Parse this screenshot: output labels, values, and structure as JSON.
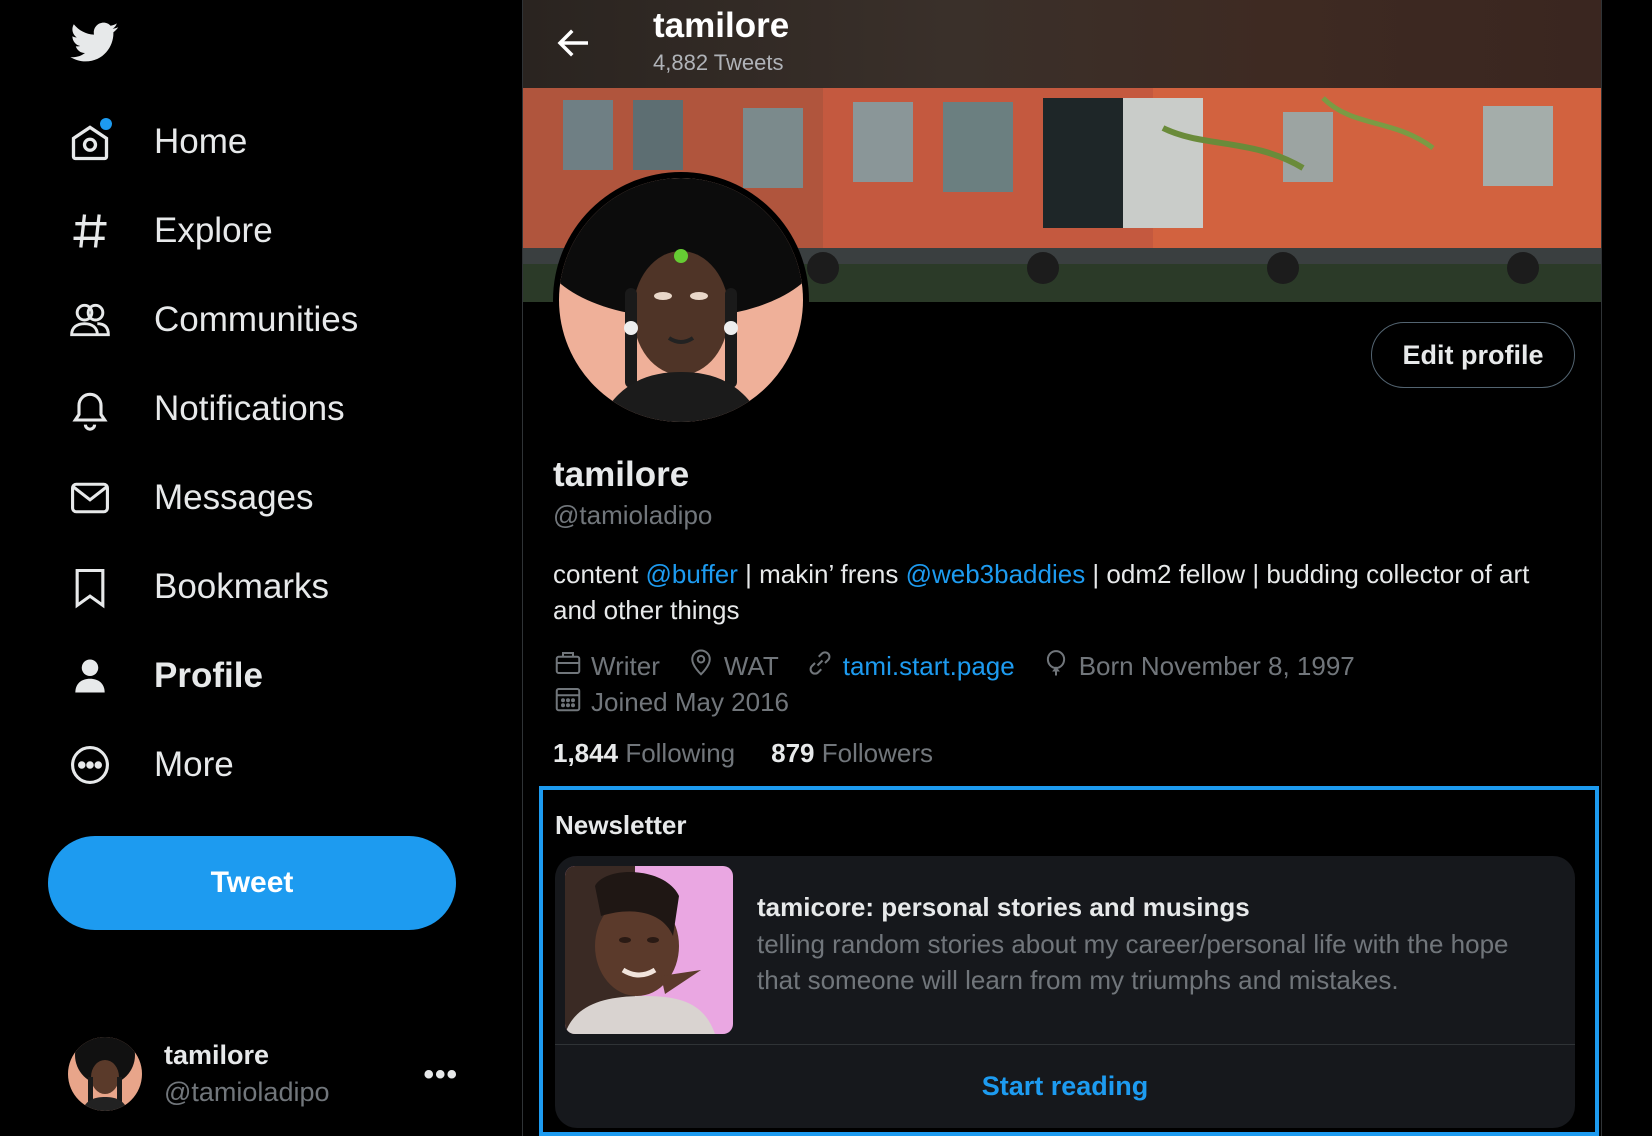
{
  "sidebar": {
    "logo": "twitter-bird-icon",
    "nav": [
      {
        "label": "Home",
        "icon": "home-icon"
      },
      {
        "label": "Explore",
        "icon": "hashtag-icon"
      },
      {
        "label": "Communities",
        "icon": "communities-icon"
      },
      {
        "label": "Notifications",
        "icon": "bell-icon"
      },
      {
        "label": "Messages",
        "icon": "envelope-icon"
      },
      {
        "label": "Bookmarks",
        "icon": "bookmark-icon"
      },
      {
        "label": "Profile",
        "icon": "person-icon"
      },
      {
        "label": "More",
        "icon": "more-circle-icon"
      }
    ],
    "tweet_label": "Tweet",
    "account": {
      "name": "tamilore",
      "handle": "@tamioladipo",
      "more": "•••"
    }
  },
  "header": {
    "title": "tamilore",
    "subtitle": "4,882 Tweets"
  },
  "profile": {
    "edit_label": "Edit profile",
    "name": "tamilore",
    "handle": "@tamioladipo",
    "bio": {
      "p1": "content ",
      "m1": "@buffer",
      "p2": " | makin’ frens ",
      "m2": "@web3baddies",
      "p3": " | odm2 fellow | budding collector of art and other things"
    },
    "meta": {
      "job": "Writer",
      "location": "WAT",
      "link": "tami.start.page",
      "birthday": "Born November 8, 1997",
      "joined": "Joined May 2016"
    },
    "stats": {
      "following_count": "1,844",
      "following_label": "Following",
      "followers_count": "879",
      "followers_label": "Followers"
    }
  },
  "newsletter": {
    "section_title": "Newsletter",
    "name": "tamicore: personal stories and musings",
    "description": "telling random stories about my career/personal life with the hope that someone will learn from my triumphs and mistakes.",
    "cta": "Start reading"
  },
  "colors": {
    "accent": "#1d9bf0",
    "background": "#000000",
    "muted": "#71767b",
    "text": "#e7e9ea"
  }
}
